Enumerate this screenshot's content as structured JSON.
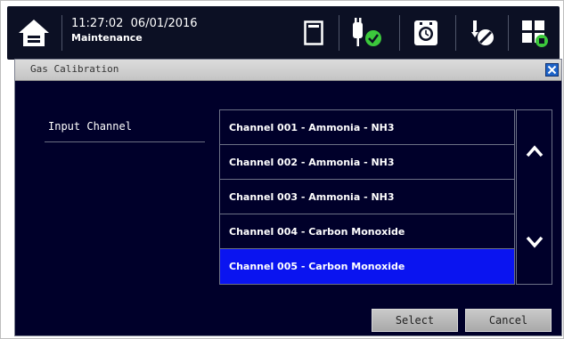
{
  "status_bar": {
    "time_date": "11:27:02  06/01/2016",
    "mode": "Maintenance",
    "icons": [
      "home-icon",
      "sd-card-icon",
      "gas-ok-icon",
      "timer-icon",
      "no-calibration-icon",
      "device-status-icon"
    ]
  },
  "dialog": {
    "title": "Gas Calibration",
    "field_label": "Input Channel",
    "channels": [
      "Channel 001 - Ammonia - NH3",
      "Channel 002 - Ammonia - NH3",
      "Channel 003 - Ammonia - NH3",
      "Channel 004 - Carbon Monoxide",
      "Channel 005 - Carbon Monoxide"
    ],
    "selected_index": 4,
    "select_label": "Select",
    "cancel_label": "Cancel"
  },
  "colors": {
    "status_bar_bg": "#0c1024",
    "dialog_bg": "#00002a",
    "selection": "#0a14f0",
    "ok_green": "#3cc83c"
  }
}
